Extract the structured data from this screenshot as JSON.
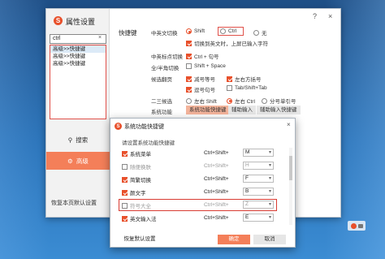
{
  "window": {
    "title": "属性设置",
    "help": "?",
    "close": "×"
  },
  "sidebar": {
    "search_value": "ctrl",
    "search_clear": "×",
    "results": [
      "高级>>快捷键",
      "高级>>快捷键",
      "高级>>快捷键"
    ],
    "nav_search": "搜索",
    "nav_advanced": "高级",
    "reset_all": "恢复本页默认设置"
  },
  "hotkeys": {
    "section_label": "快捷键",
    "cn_en_label": "中英文切换",
    "cn_en_options": [
      "Shift",
      "Ctrl",
      "无"
    ],
    "cn_en_selected": "Ctrl",
    "cn_en_extra": "切换到英文时，上屏已输入字符",
    "punct_label": "中英标点切换",
    "punct_option": "Ctrl + 句号",
    "fullhalf_label": "全/半角切换",
    "fullhalf_option": "Shift + Space",
    "pageturn_label": "候选翻页",
    "pageturn_options": [
      "减号等号",
      "左右方括号",
      "逗号句号",
      "Tab/Shift+Tab"
    ],
    "second_third_label": "二三候选",
    "second_third_options": [
      "左右 Shift",
      "左右 Ctrl",
      "分号单引号"
    ],
    "second_third_selected": "左右 Ctrl",
    "sysfunc_label": "系统功能",
    "sysfunc_buttons": [
      "系统功能快捷键",
      "辅助输入",
      "辅助输入快捷键"
    ]
  },
  "dialog": {
    "title": "系统功能快捷键",
    "close": "×",
    "subtitle": "请设置系统功能快捷键",
    "rows": [
      {
        "name": "系统菜单",
        "mod": "Ctrl+Shift+",
        "key": "M",
        "checked": true,
        "disabled": false
      },
      {
        "name": "随便换肤",
        "mod": "Ctrl+Shift+",
        "key": "H",
        "checked": false,
        "disabled": true
      },
      {
        "name": "简繁切换",
        "mod": "Ctrl+Shift+",
        "key": "F",
        "checked": true,
        "disabled": false
      },
      {
        "name": "颜文字",
        "mod": "Ctrl+Shift+",
        "key": "B",
        "checked": true,
        "disabled": false
      },
      {
        "name": "符号大全",
        "mod": "Ctrl+Shift+",
        "key": "Z",
        "checked": false,
        "disabled": true
      },
      {
        "name": "英文输入法",
        "mod": "Ctrl+Shift+",
        "key": "E",
        "checked": true,
        "disabled": false
      }
    ],
    "restore_default": "恢复默认设置",
    "ok": "确定",
    "cancel": "取消"
  },
  "colors": {
    "accent": "#e8502b",
    "nav_active": "#f47f59",
    "highlight": "#d93c33"
  }
}
